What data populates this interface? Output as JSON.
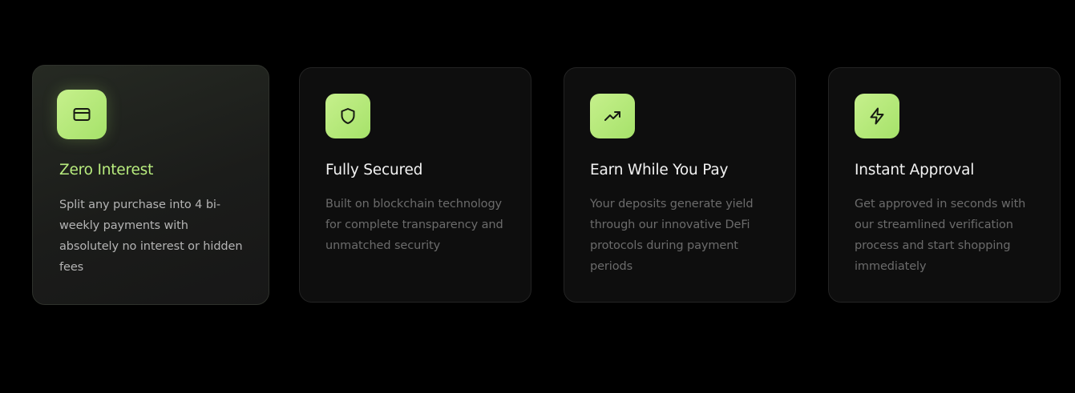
{
  "features": [
    {
      "title": "Zero Interest",
      "description": "Split any purchase into 4 bi-weekly payments with absolutely no interest or hidden fees",
      "icon": "credit-card-icon",
      "active": true
    },
    {
      "title": "Fully Secured",
      "description": "Built on blockchain technology for complete transparency and unmatched security",
      "icon": "shield-icon",
      "active": false
    },
    {
      "title": "Earn While You Pay",
      "description": "Your deposits generate yield through our innovative DeFi protocols during payment periods",
      "icon": "trending-up-icon",
      "active": false
    },
    {
      "title": "Instant Approval",
      "description": "Get approved in seconds with our streamlined verification process and start shopping immediately",
      "icon": "lightning-bolt-icon",
      "active": false
    }
  ],
  "colors": {
    "accent": "#b8ec7e",
    "icon_tile": "#b2e878",
    "card_bg": "#0e0e0e",
    "page_bg": "#000000"
  }
}
